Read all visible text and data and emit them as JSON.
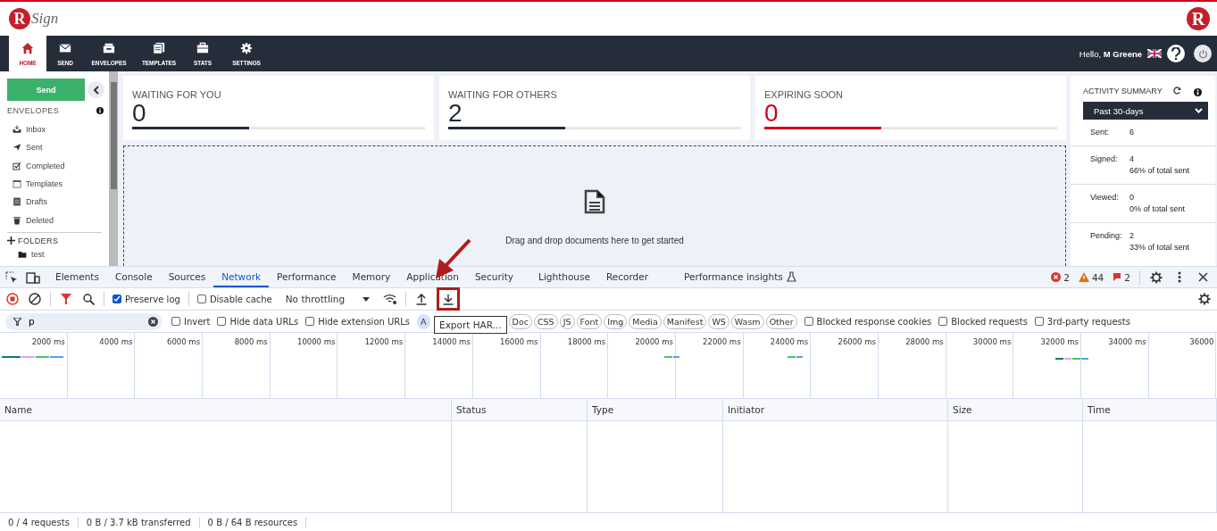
{
  "header": {
    "logo_mark": "R",
    "logo_text": "Sign",
    "corner_mark": "R"
  },
  "nav": {
    "items": [
      {
        "label": "HOME",
        "selected": true
      },
      {
        "label": "SEND",
        "selected": false
      },
      {
        "label": "ENVELOPES",
        "selected": false
      },
      {
        "label": "TEMPLATES",
        "selected": false
      },
      {
        "label": "STATS",
        "selected": false
      },
      {
        "label": "SETTINGS",
        "selected": false
      }
    ],
    "greeting": "Hello, **M Greene**"
  },
  "sidebar": {
    "send": "Send",
    "section": "ENVELOPES",
    "items": [
      "Inbox",
      "Sent",
      "Completed",
      "Templates",
      "Drafts",
      "Deleted"
    ],
    "folders_heading": "FOLDERS",
    "folders": [
      "test"
    ]
  },
  "stats": [
    {
      "label": "WAITING FOR YOU",
      "value": "0",
      "level": 0.4,
      "color": "#222b38"
    },
    {
      "label": "WAITING FOR OTHERS",
      "value": "2",
      "level": 0.4,
      "color": "#222b38"
    },
    {
      "label": "EXPIRING SOON",
      "value": "0",
      "level": 0.4,
      "color": "#d0021b"
    }
  ],
  "dropzone": {
    "text": "Drag and drop documents here to get started"
  },
  "activity": {
    "title": "ACTIVITY SUMMARY",
    "period": "Past 30-days",
    "rows": [
      {
        "label": "Sent:",
        "value": "6"
      },
      {
        "label": "Signed:",
        "value": "4",
        "note": "66% of total sent"
      },
      {
        "label": "Viewed:",
        "value": "0",
        "note": "0% of total sent"
      },
      {
        "label": "Pending:",
        "value": "2",
        "note": "33% of total sent"
      }
    ]
  },
  "devtools": {
    "tabs": [
      {
        "label": "Elements",
        "selected": false
      },
      {
        "label": "Console",
        "selected": false
      },
      {
        "label": "Sources",
        "selected": false
      },
      {
        "label": "Network",
        "selected": true
      },
      {
        "label": "Performance",
        "selected": false
      },
      {
        "label": "Memory",
        "selected": false
      },
      {
        "label": "Application",
        "selected": false
      },
      {
        "label": "Security",
        "selected": false
      },
      {
        "label": "Lighthouse",
        "selected": false
      },
      {
        "label": "Recorder",
        "selected": false
      },
      {
        "label": "Performance insights",
        "selected": false
      }
    ],
    "errors": "2",
    "warnings": "44",
    "issues": "2",
    "preserve_log": {
      "label": "Preserve log",
      "checked": true
    },
    "disable_cache": {
      "label": "Disable cache",
      "checked": false
    },
    "throttling": "No throttling",
    "filter_value": "p",
    "filter_options": [
      {
        "label": "Invert",
        "checked": false
      },
      {
        "label": "Hide data URLs",
        "checked": false
      },
      {
        "label": "Hide extension URLs",
        "checked": false
      }
    ],
    "types": [
      {
        "label": "A",
        "selected": true
      },
      {
        "label": "Doc",
        "selected": false
      },
      {
        "label": "CSS",
        "selected": false
      },
      {
        "label": "JS",
        "selected": false
      },
      {
        "label": "Font",
        "selected": false
      },
      {
        "label": "Img",
        "selected": false
      },
      {
        "label": "Media",
        "selected": false
      },
      {
        "label": "Manifest",
        "selected": false
      },
      {
        "label": "WS",
        "selected": false
      },
      {
        "label": "Wasm",
        "selected": false
      },
      {
        "label": "Other",
        "selected": false
      }
    ],
    "more_options": [
      {
        "label": "Blocked response cookies",
        "checked": false
      },
      {
        "label": "Blocked requests",
        "checked": false
      },
      {
        "label": "3rd-party requests",
        "checked": false
      }
    ],
    "tooltip": "Export HAR...",
    "ticks": [
      "2000 ms",
      "4000 ms",
      "6000 ms",
      "8000 ms",
      "10000 ms",
      "12000 ms",
      "14000 ms",
      "16000 ms",
      "18000 ms",
      "20000 ms",
      "22000 ms",
      "24000 ms",
      "26000 ms",
      "28000 ms",
      "30000 ms",
      "32000 ms",
      "34000 ms",
      "36000"
    ],
    "columns": [
      "Name",
      "Status",
      "Type",
      "Initiator",
      "Size",
      "Time"
    ],
    "status": [
      "0 / 4 requests",
      "0 B / 3.7 kB transferred",
      "0 B / 64 B resources"
    ]
  }
}
